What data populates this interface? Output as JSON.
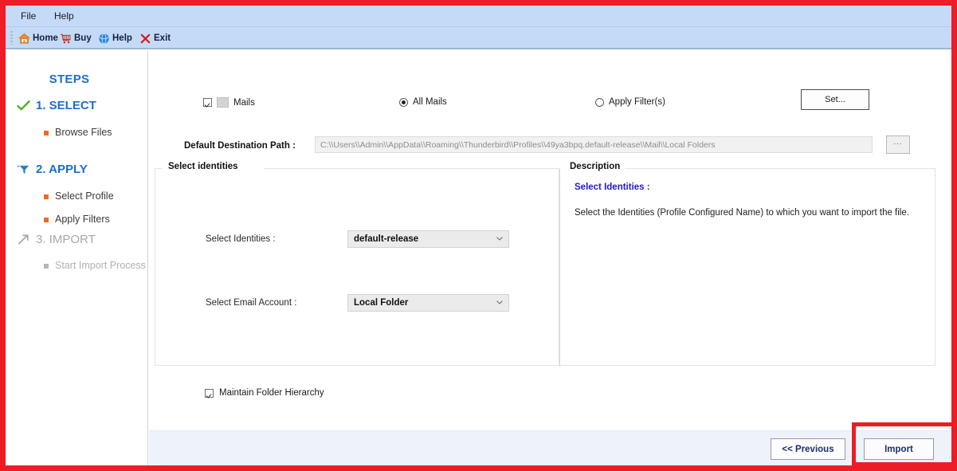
{
  "window": {
    "accent_blue": "#1f6fc4",
    "annotation_color": "#ee1c25"
  },
  "menubar": {
    "items": [
      {
        "label": "File"
      },
      {
        "label": "Help"
      }
    ]
  },
  "toolbar": {
    "buttons": [
      {
        "label": "Home",
        "icon": "home-icon"
      },
      {
        "label": "Buy",
        "icon": "shopping-cart-icon"
      },
      {
        "label": "Help",
        "icon": "help-globe-icon"
      },
      {
        "label": "Exit",
        "icon": "close-x-icon"
      }
    ]
  },
  "sidebar": {
    "title": "STEPS",
    "steps": [
      {
        "label": "1. SELECT",
        "icon": "check-mark-icon",
        "state": "completed",
        "substeps": [
          {
            "label": "Browse Files",
            "state": "done"
          }
        ]
      },
      {
        "label": "2. APPLY",
        "icon": "filter-funnel-icon",
        "state": "active",
        "substeps": [
          {
            "label": "Select Profile",
            "state": "active"
          },
          {
            "label": "Apply Filters",
            "state": "active"
          }
        ]
      },
      {
        "label": "3. IMPORT",
        "icon": "arrow-up-right-icon",
        "state": "disabled",
        "substeps": [
          {
            "label": "Start Import Process",
            "state": "disabled"
          }
        ]
      }
    ]
  },
  "main": {
    "mails_checkbox": {
      "label": "Mails",
      "checked": true
    },
    "mail_scope": {
      "selected": "All Mails",
      "options": [
        "All Mails",
        "Apply Filter(s)"
      ],
      "all_mails_label": "All Mails",
      "apply_filters_label": "Apply Filter(s)"
    },
    "set_button_label": "Set...",
    "destination": {
      "label": "Default Destination Path :",
      "value": "C:\\\\Users\\\\Admin\\\\AppData\\\\Roaming\\\\Thunderbird\\\\Profiles\\\\49ya3bpq.default-release\\\\Mail\\\\Local Folders",
      "placeholder": "C:\\\\Users\\\\Admin\\\\AppData\\\\Roaming\\\\Thunderbird\\\\Profiles\\\\49ya3bpq.default-release\\\\Mail\\\\Local Folders",
      "browse_button_label": "..."
    },
    "identities_group": {
      "title": "Select identities",
      "fields": [
        {
          "label": "Select Identities :",
          "value": "default-release",
          "options": [
            "default-release"
          ]
        },
        {
          "label": "Select Email Account :",
          "value": "Local Folder",
          "options": [
            "Local Folder"
          ]
        }
      ]
    },
    "description_group": {
      "title": "Description",
      "heading": "Select Identities :",
      "body": "Select the Identities (Profile Configured Name) to  which  you want to import the file.",
      "heading_color": "#2118cf"
    },
    "hierarchy_checkbox": {
      "label": "Maintain Folder Hierarchy",
      "checked": true
    },
    "footer": {
      "previous_label": "<< Previous",
      "import_label": "Import"
    }
  }
}
